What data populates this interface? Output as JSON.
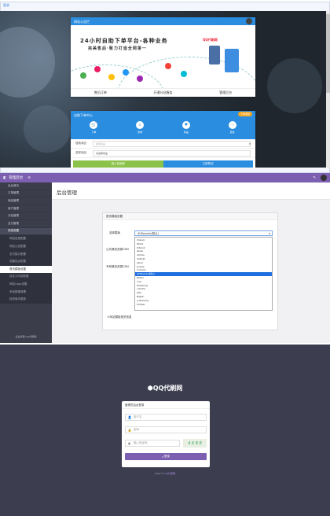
{
  "site": {
    "brand": "QQ代刷网",
    "login_label": "登录"
  },
  "hero_card": {
    "header_text": "网站公告栏",
    "title_line1": "24小时自助下单平台-各种业务",
    "title_line2": "完美售后·致力打造全网第一",
    "logo_text": "QQ代刷网",
    "footer": [
      "售后订单",
      "开通分站服务",
      "管理后台"
    ]
  },
  "order_card": {
    "header_text": "自助下单中心",
    "header_button": "下单须知",
    "tabs": [
      "下单",
      "查单",
      "商品",
      "更多"
    ],
    "row1_label": "搜索商品",
    "row1_placeholder": "搜索商品",
    "row2_label": "选择商品",
    "row2_value": "请选择商品",
    "btn_left": "进入商品库",
    "btn_right": "立即购买"
  },
  "admin": {
    "app_title": "管理后台",
    "breadcrumb": "后台管理",
    "sidebar": [
      "后台首页",
      "订单管理",
      "商品管理",
      "用户管理",
      "分站管理",
      "支付管理",
      "系统设置"
    ],
    "sub_items": [
      "网站信息配置",
      "网站公告配置",
      "支付接口配置",
      "克隆站点配置",
      "首页模板设置",
      "自定义内容配置",
      "网站Logo设置",
      "系统数据清理",
      "检查版本更新"
    ],
    "footer": "后台管理 QQ代刷网",
    "panel_title": "首页模板设置",
    "label_template": "选择模板",
    "label_cdn1": "公共静态资源CDN",
    "label_cdn2": "专有静态资源CDN",
    "selected": "XUEpaotu(默认)",
    "options": [
      "Classic",
      "Moral",
      "Odeluk",
      "Glass",
      "simple",
      "default",
      "Ljkue",
      "purple",
      "Colmod",
      "XUEpaotu(默认)",
      "Mdzui",
      "cool",
      "Hearbing",
      "colorful",
      "Gify",
      "Bigbin",
      "yuanhang",
      "Simple"
    ],
    "selected_index": 9,
    "note": "网站模板相关信息"
  },
  "login": {
    "logo": "QQ代刷网",
    "box_title": "管理员后台登录",
    "user_placeholder": "用户名",
    "pass_placeholder": "密码",
    "captcha_placeholder": "输入验证码",
    "captcha_text": "4 K 8 8",
    "submit": "登录",
    "copyright": "2020 ©",
    "copyright_brand": "QQ代刷网"
  },
  "colors": {
    "brand_purple": "#7c5fb0",
    "brand_blue": "#2a8de0",
    "orange": "#f5a623",
    "green": "#8bc34a"
  }
}
